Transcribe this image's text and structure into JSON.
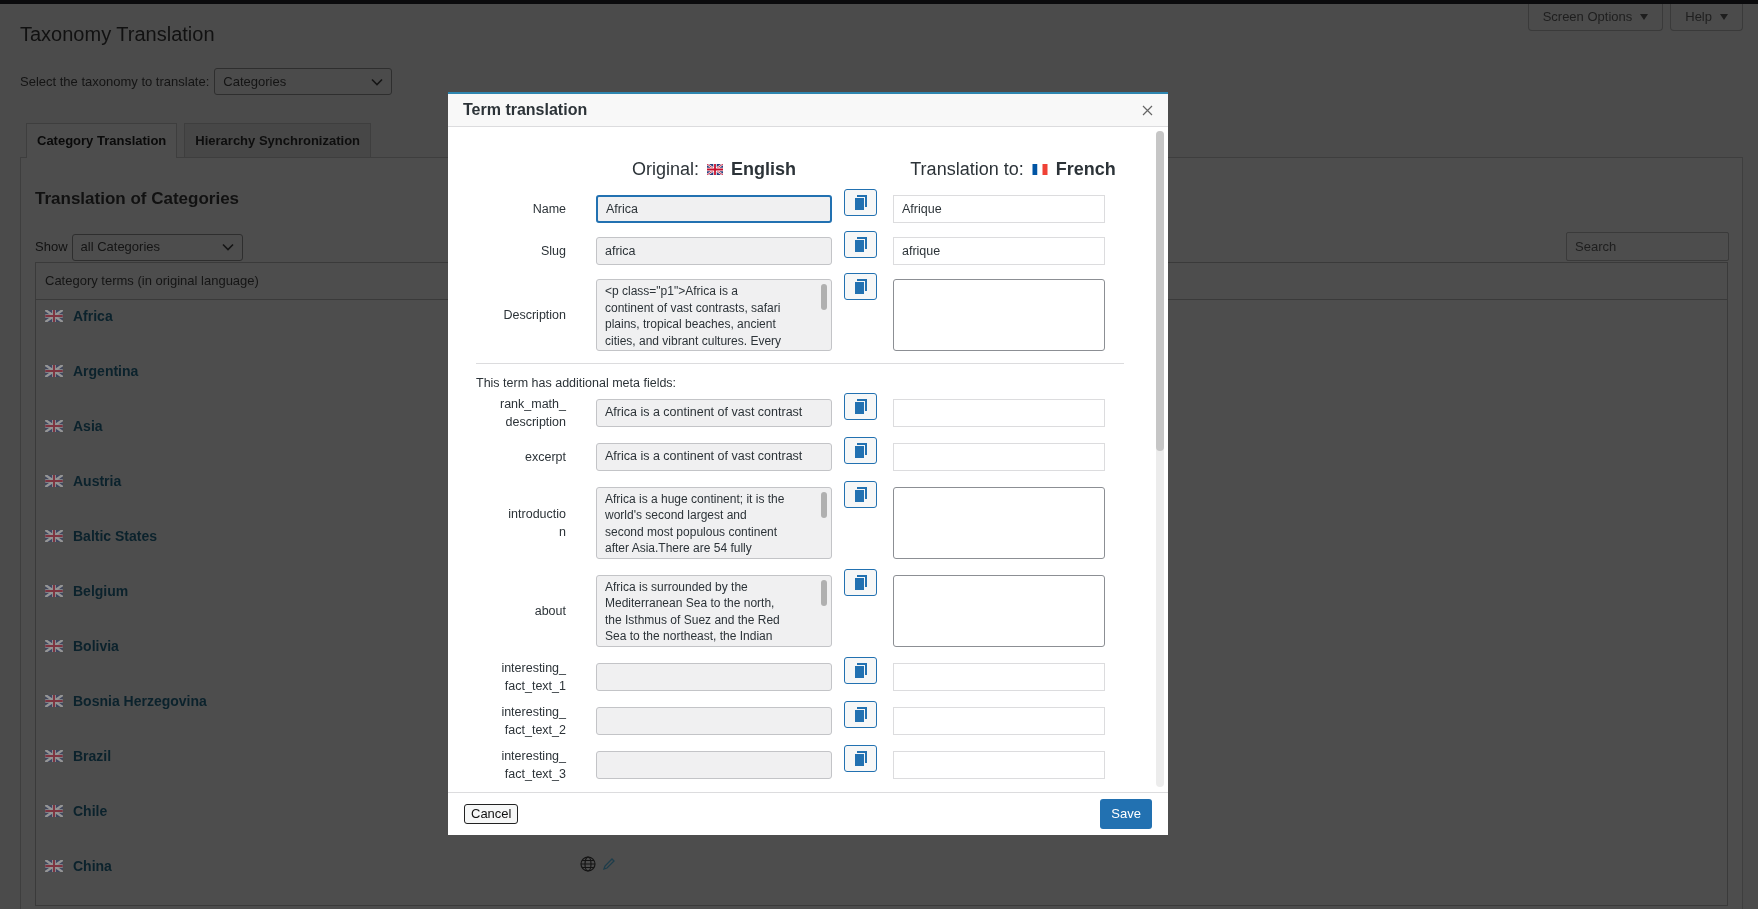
{
  "page": {
    "title": "Taxonomy Translation",
    "taxonomy_label": "Select the taxonomy to translate:",
    "taxonomy_value": "Categories"
  },
  "header_buttons": [
    "Screen Options",
    "Help"
  ],
  "tabs": [
    {
      "label": "Category Translation",
      "selected": true
    },
    {
      "label": "Hierarchy Synchronization",
      "selected": false
    }
  ],
  "section_title": "Translation of Categories",
  "show_label": "Show",
  "show_value": "all Categories",
  "search": {
    "placeholder": "Search"
  },
  "table": {
    "column": "Category terms (in original language)",
    "rows": [
      {
        "name": "Africa",
        "has_actions": false
      },
      {
        "name": "Argentina",
        "has_actions": false
      },
      {
        "name": "Asia",
        "has_actions": false
      },
      {
        "name": "Austria",
        "has_actions": false
      },
      {
        "name": "Baltic States",
        "has_actions": false
      },
      {
        "name": "Belgium",
        "has_actions": false
      },
      {
        "name": "Bolivia",
        "has_actions": false
      },
      {
        "name": "Bosnia Herzegovina",
        "has_actions": false
      },
      {
        "name": "Brazil",
        "has_actions": false
      },
      {
        "name": "Chile",
        "has_actions": false
      },
      {
        "name": "China",
        "has_actions": true
      }
    ]
  },
  "modal": {
    "title": "Term translation",
    "original_label": "Original:",
    "original_language": "English",
    "translation_label": "Translation to:",
    "translation_language": "French",
    "meta_note": "This term has additional meta fields:",
    "fields": [
      {
        "label_lines": [
          "Name"
        ],
        "kind": "input",
        "value": "Africa",
        "translation": "Afrique",
        "focused": true
      },
      {
        "label_lines": [
          "Slug"
        ],
        "kind": "input",
        "value": "africa",
        "translation": "afrique",
        "focused": false
      },
      {
        "label_lines": [
          "Description"
        ],
        "kind": "textarea",
        "lines": [
          "<p class=\"p1\">Africa is a",
          "continent of vast contrasts, safari",
          "plains, tropical beaches, ancient",
          "cities, and vibrant cultures. Every"
        ],
        "focused": false
      }
    ],
    "meta_fields": [
      {
        "label_lines": [
          "rank_math_",
          "description"
        ],
        "kind": "input",
        "value": "Africa is a continent of vast contrast",
        "focused": false
      },
      {
        "label_lines": [
          "excerpt"
        ],
        "kind": "input",
        "value": "Africa is a continent of vast contrast",
        "focused": false
      },
      {
        "label_lines": [
          "introductio",
          "n"
        ],
        "kind": "textarea",
        "lines": [
          "Africa is a huge continent; it is the",
          "world's second largest and",
          "second most populous continent",
          "after Asia.There are 54 fully"
        ],
        "focused": false
      },
      {
        "label_lines": [
          "about"
        ],
        "kind": "textarea",
        "lines": [
          "Africa is surrounded by the",
          "Mediterranean Sea to the north,",
          "the Isthmus of Suez and the Red",
          "Sea to the northeast, the Indian"
        ],
        "focused": false
      },
      {
        "label_lines": [
          "interesting_",
          "fact_text_1"
        ],
        "kind": "input",
        "focused": false
      },
      {
        "label_lines": [
          "interesting_",
          "fact_text_2"
        ],
        "kind": "input",
        "focused": false
      },
      {
        "label_lines": [
          "interesting_",
          "fact_text_3"
        ],
        "kind": "input",
        "focused": false
      }
    ],
    "cancel": "Cancel",
    "save": "Save"
  }
}
